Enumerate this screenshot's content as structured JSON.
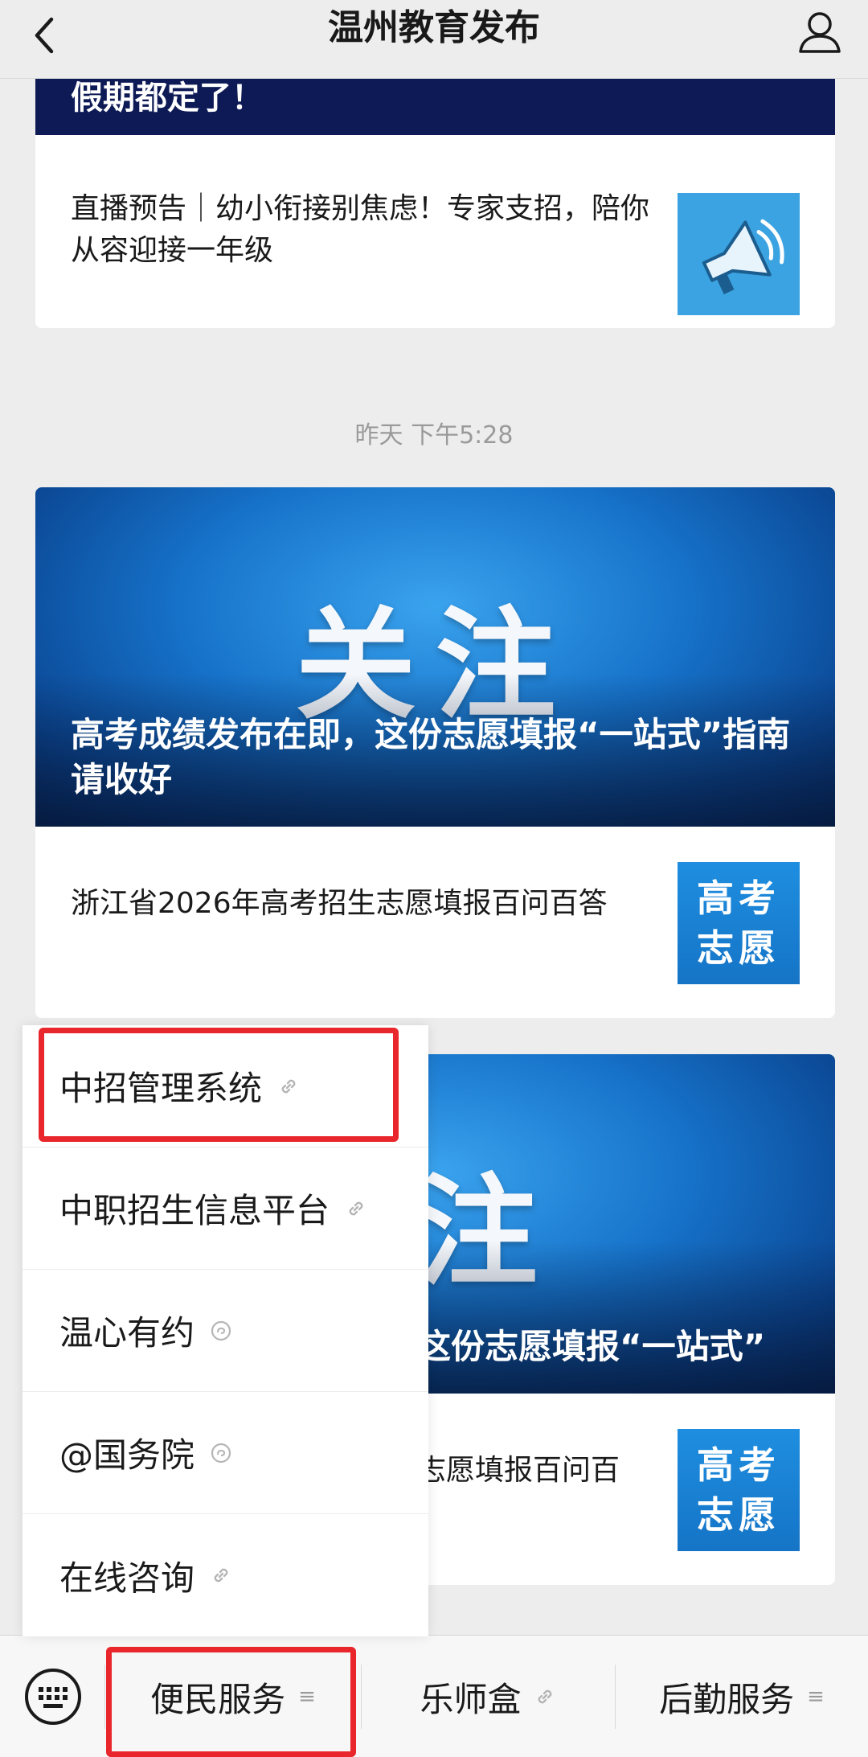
{
  "header": {
    "title": "温州教育发布"
  },
  "feed": {
    "banner_partial_title": "假期都定了！",
    "article1": {
      "title": "直播预告｜幼小衔接别焦虑！专家支招，陪你从容迎接一年级"
    },
    "timestamp": "昨天 下午5:28",
    "article2": {
      "banner_big_text": "关注",
      "banner_headline": "高考成绩发布在即，这份志愿填报“一站式”指南请收好",
      "sub_title": "浙江省2026年高考招生志愿填报百问百答",
      "thumb_line1": "高考",
      "thumb_line2": "志愿"
    },
    "article3": {
      "banner_big_text": "注",
      "banner_headline_partial": "这份志愿填报“一站式”",
      "sub_title_partial": "志愿填报百问百",
      "thumb_line1": "高考",
      "thumb_line2": "志愿"
    }
  },
  "submenu": {
    "items": [
      {
        "label": "中招管理系统",
        "icon": "link-icon"
      },
      {
        "label": "中职招生信息平台",
        "icon": "link-icon"
      },
      {
        "label": "温心有约",
        "icon": "mini-program-icon"
      },
      {
        "label": "@国务院",
        "icon": "mini-program-icon"
      },
      {
        "label": "在线咨询",
        "icon": "link-icon"
      }
    ]
  },
  "bottom_menu": {
    "tab1": {
      "label": "便民服务",
      "suffix": "≡"
    },
    "tab2": {
      "label": "乐师盒",
      "icon": "link-icon"
    },
    "tab3": {
      "label": "后勤服务",
      "suffix": "≡"
    }
  },
  "colors": {
    "highlight": "#e8262b",
    "banner_blue": "#1672c9",
    "background": "#ededed"
  }
}
